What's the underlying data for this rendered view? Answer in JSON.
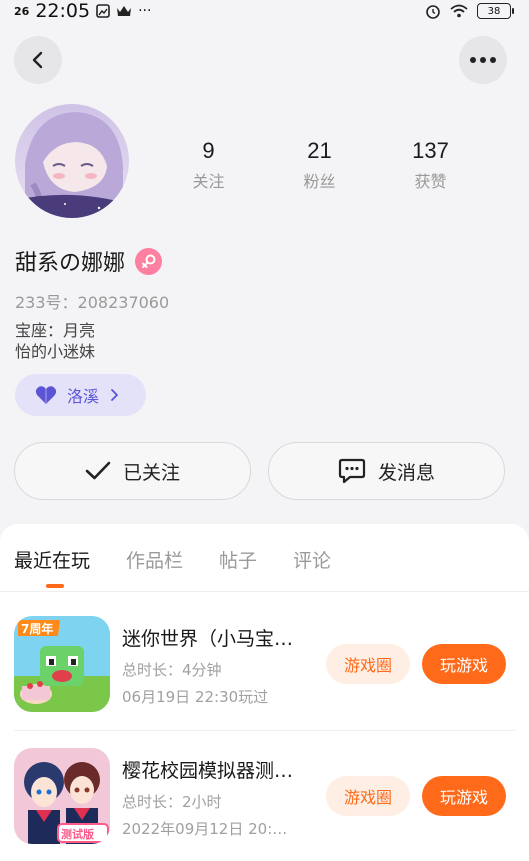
{
  "status_bar": {
    "signal": "26",
    "time": "22:05",
    "extra": "···",
    "battery": "38"
  },
  "nav": {
    "back_icon": "chevron-left-icon",
    "more_icon": "more-horizontal-icon"
  },
  "profile": {
    "stats": [
      {
        "value": "9",
        "label": "关注"
      },
      {
        "value": "21",
        "label": "粉丝"
      },
      {
        "value": "137",
        "label": "获赞"
      }
    ],
    "username": "甜系の娜娜",
    "gender": "female",
    "uid": "233号：208237060",
    "bio_lines": [
      "宝座：月亮",
      "怡的小迷妹"
    ],
    "tag": {
      "label": "洛溪",
      "icon": "heart-icon",
      "color": "#5b55d6"
    }
  },
  "actions": {
    "follow_label": "已关注",
    "message_label": "发消息"
  },
  "tabs": [
    {
      "label": "最近在玩",
      "active": true
    },
    {
      "label": "作品栏",
      "active": false
    },
    {
      "label": "帖子",
      "active": false
    },
    {
      "label": "评论",
      "active": false
    }
  ],
  "games": [
    {
      "title": "迷你世界（小马宝…",
      "duration": "总时长：4分钟",
      "last_played": "06月19日 22:30玩过",
      "badge": "7周年",
      "circle_label": "游戏圈",
      "play_label": "玩游戏"
    },
    {
      "title": "樱花校园模拟器测…",
      "duration": "总时长：2小时",
      "last_played": "2022年09月12日 20:…",
      "badge": "测试版",
      "circle_label": "游戏圈",
      "play_label": "玩游戏"
    }
  ],
  "colors": {
    "accent": "#ff6a1a",
    "accent_light": "#ffeee3",
    "tag_bg": "#e4e2f8",
    "gender_pink": "#ff7fa0"
  }
}
